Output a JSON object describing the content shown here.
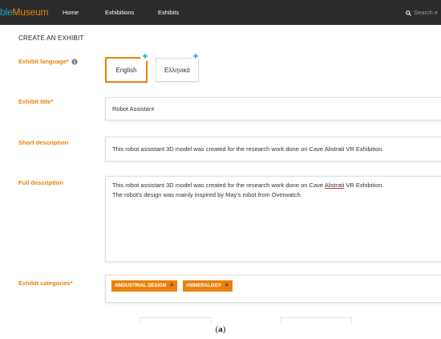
{
  "topbar": {
    "logo_part1": "ble",
    "logo_part2": "Museum",
    "nav": [
      "Home",
      "Exhibitions",
      "Exhibits"
    ],
    "search_placeholder": "Search e"
  },
  "page": {
    "title": "CREATE AN EXHIBIT"
  },
  "form": {
    "language_label": "Exhibit language*",
    "languages": [
      "English",
      "Ελληνικά"
    ],
    "active_language": "English",
    "title_label": "Exhibit title*",
    "title_value": "Robot Assistant",
    "short_desc_label": "Short description",
    "short_desc_value": "This robot assistant 3D model was created for the research work done on Cave Alistrati VR Exhibition.",
    "full_desc_label": "Full description",
    "full_desc_line1_a": "This robot assistant 3D model was created for the research work done on Cave ",
    "full_desc_line1_b": "Alistrati",
    "full_desc_line1_c": " VR Exhibition.",
    "full_desc_line2": "The robot's design was mainly inspired by May's robot from Overwatch.",
    "categories_label": "Exhibit categories*",
    "categories": [
      "#INDUSTRIAL DESIGN",
      "#MINERALOGY"
    ]
  },
  "caption": {
    "text": "(a)"
  },
  "colors": {
    "accent": "#e8820c",
    "topbar": "#2b2b2b",
    "plus": "#1a9ad6",
    "logo_blue": "#1fa3c9"
  },
  "icons": [
    "search-icon",
    "info-icon",
    "plus-icon",
    "close-icon"
  ]
}
